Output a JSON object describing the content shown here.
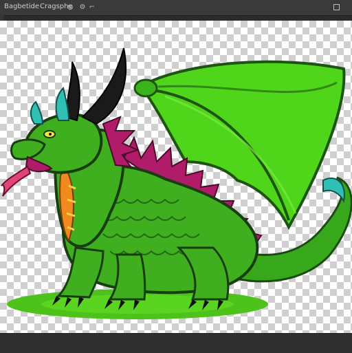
{
  "window": {
    "title": "Bagbetide",
    "document_tab": "Cragsphe"
  },
  "toolbar": {
    "icons": [
      "globe-icon",
      "gear-icon",
      "crop-icon",
      "frame-icon"
    ]
  },
  "canvas": {
    "background": "transparent-checkerboard",
    "subject": "green-dragon-illustration"
  },
  "colors": {
    "app_background": "#2b2b2b",
    "dragon_green": "#3fae1f",
    "wing_green": "#4fd61b",
    "belly_orange": "#f18a1c",
    "spine_magenta": "#b01c6a",
    "ground_green": "#4cc21a"
  },
  "status": {
    "text": ""
  }
}
